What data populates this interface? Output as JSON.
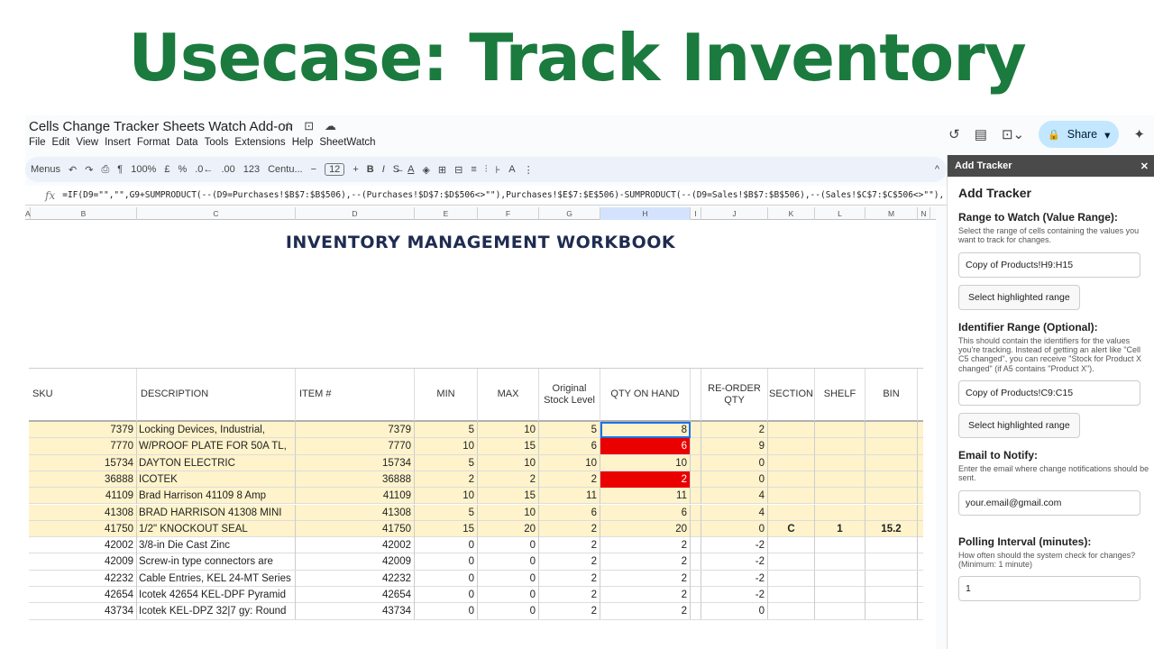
{
  "headline": "Usecase: Track Inventory",
  "doc": {
    "title": "Cells Change Tracker  Sheets Watch Add-on",
    "star": "☆",
    "folder": "⊡",
    "cloud": "☁"
  },
  "menu": [
    "File",
    "Edit",
    "View",
    "Insert",
    "Format",
    "Data",
    "Tools",
    "Extensions",
    "Help",
    "SheetWatch"
  ],
  "topbar": {
    "history": "↺",
    "comment": "▤",
    "meet": "⊡⌄",
    "share": "Share",
    "share_icon": "🔒",
    "gemini": "✦"
  },
  "toolbar": {
    "menus": "Menus",
    "undo": "↶",
    "redo": "↷",
    "print": "⎙",
    "paint": "¶",
    "zoom": "100%",
    "currency": "£",
    "percent": "%",
    "dec_less": ".0←",
    "dec_more": ".00",
    "format123": "123",
    "font": "Centu...",
    "minus": "−",
    "font_size": "12",
    "plus": "+",
    "bold": "B",
    "italic": "I",
    "strike": "S̶",
    "color": "A",
    "fill": "◈",
    "borders": "⊞",
    "merge": "⊟",
    "align": "≡",
    "valign": "⫶",
    "wrap": "⊦",
    "rotate": "A",
    "more": "⋮",
    "collapse": "^"
  },
  "formula": {
    "fx": "fx",
    "text": "=IF(D9=\"\",\"\",G9+SUMPRODUCT(--(D9=Purchases!$B$7:$B$506),--(Purchases!$D$7:$D$506<>\"\"),Purchases!$E$7:$E$506)-SUMPRODUCT(--(D9=Sales!$B$7:$B$506),--(Sales!$C$7:$C$506<>\"\"),"
  },
  "columns": [
    "A",
    "B",
    "C",
    "D",
    "E",
    "F",
    "G",
    "H",
    "I",
    "J",
    "K",
    "L",
    "M",
    "N"
  ],
  "sheet_title": "INVENTORY MANAGEMENT  WORKBOOK",
  "headers": {
    "sku": "SKU",
    "description": "DESCRIPTION",
    "item": "ITEM #",
    "min": "MIN",
    "max": "MAX",
    "orig1": "Original",
    "orig2": "Stock Level",
    "qty": "QTY ON HAND",
    "re1": "RE-ORDER",
    "re2": "QTY",
    "section": "SECTION",
    "shelf": "SHELF",
    "bin": "BIN"
  },
  "rows": [
    {
      "sku": "7379",
      "desc": "Locking Devices, Industrial,",
      "item": "7379",
      "min": "5",
      "max": "10",
      "orig": "5",
      "qty": "8",
      "reorder": "2",
      "section": "",
      "shelf": "",
      "bin": "",
      "hl": true,
      "red": false,
      "sel": true
    },
    {
      "sku": "7770",
      "desc": "W/PROOF PLATE FOR 50A TL,",
      "item": "7770",
      "min": "10",
      "max": "15",
      "orig": "6",
      "qty": "6",
      "reorder": "9",
      "section": "",
      "shelf": "",
      "bin": "",
      "hl": true,
      "red": true
    },
    {
      "sku": "15734",
      "desc": "DAYTON ELECTRIC",
      "item": "15734",
      "min": "5",
      "max": "10",
      "orig": "10",
      "qty": "10",
      "reorder": "0",
      "section": "",
      "shelf": "",
      "bin": "",
      "hl": true,
      "red": false
    },
    {
      "sku": "36888",
      "desc": "ICOTEK",
      "item": "36888",
      "min": "2",
      "max": "2",
      "orig": "2",
      "qty": "2",
      "reorder": "0",
      "section": "",
      "shelf": "",
      "bin": "",
      "hl": true,
      "red": true
    },
    {
      "sku": "41109",
      "desc": "Brad Harrison 41109 8 Amp",
      "item": "41109",
      "min": "10",
      "max": "15",
      "orig": "11",
      "qty": "11",
      "reorder": "4",
      "section": "",
      "shelf": "",
      "bin": "",
      "hl": true,
      "red": false
    },
    {
      "sku": "41308",
      "desc": "BRAD HARRISON 41308 MINI",
      "item": "41308",
      "min": "5",
      "max": "10",
      "orig": "6",
      "qty": "6",
      "reorder": "4",
      "section": "",
      "shelf": "",
      "bin": "",
      "hl": true,
      "red": false
    },
    {
      "sku": "41750",
      "desc": "1/2\"  KNOCKOUT SEAL",
      "item": "41750",
      "min": "15",
      "max": "20",
      "orig": "2",
      "qty": "20",
      "reorder": "0",
      "section": "C",
      "shelf": "1",
      "bin": "15.2",
      "hl": true,
      "red": false
    },
    {
      "sku": "42002",
      "desc": "3/8-in Die Cast Zinc",
      "item": "42002",
      "min": "0",
      "max": "0",
      "orig": "2",
      "qty": "2",
      "reorder": "-2",
      "section": "",
      "shelf": "",
      "bin": "",
      "hl": false,
      "red": false
    },
    {
      "sku": "42009",
      "desc": "Screw-in type connectors are",
      "item": "42009",
      "min": "0",
      "max": "0",
      "orig": "2",
      "qty": "2",
      "reorder": "-2",
      "section": "",
      "shelf": "",
      "bin": "",
      "hl": false,
      "red": false
    },
    {
      "sku": "42232",
      "desc": "Cable Entries, KEL 24-MT Series",
      "item": "42232",
      "min": "0",
      "max": "0",
      "orig": "2",
      "qty": "2",
      "reorder": "-2",
      "section": "",
      "shelf": "",
      "bin": "",
      "hl": false,
      "red": false
    },
    {
      "sku": "42654",
      "desc": "Icotek 42654 KEL-DPF Pyramid",
      "item": "42654",
      "min": "0",
      "max": "0",
      "orig": "2",
      "qty": "2",
      "reorder": "-2",
      "section": "",
      "shelf": "",
      "bin": "",
      "hl": false,
      "red": false
    },
    {
      "sku": "43734",
      "desc": "Icotek KEL-DPZ 32|7 gy: Round",
      "item": "43734",
      "min": "0",
      "max": "0",
      "orig": "2",
      "qty": "2",
      "reorder": "0",
      "section": "",
      "shelf": "",
      "bin": "",
      "hl": false,
      "red": false
    }
  ],
  "panel": {
    "header": "Add Tracker",
    "close": "✕",
    "title": "Add Tracker",
    "range_label": "Range to Watch (Value Range):",
    "range_help": "Select the range of cells containing the values you want to track for changes.",
    "range_value": "Copy of Products!H9:H15",
    "select_btn": "Select highlighted range",
    "id_label": "Identifier Range (Optional):",
    "id_help": "This should contain the identifiers for the values you're tracking. Instead of getting an alert like \"Cell C5 changed\", you can receive \"Stock for Product X changed\" (if A5 contains \"Product X\").",
    "id_value": "Copy of Products!C9:C15",
    "email_label": "Email to Notify:",
    "email_help": "Enter the email where change notifications should be sent.",
    "email_value": "your.email@gmail.com",
    "poll_label": "Polling Interval (minutes):",
    "poll_help": "How often should the system check for changes? (Minimum: 1 minute)",
    "poll_value": "1"
  }
}
